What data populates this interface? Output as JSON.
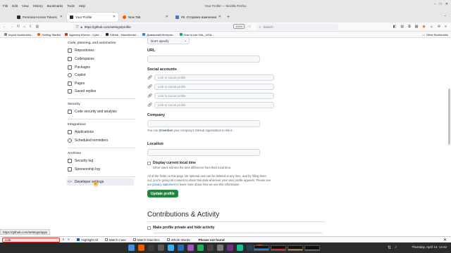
{
  "window": {
    "title": "Your Profile — Mozilla Firefox"
  },
  "menu": [
    "File",
    "Edit",
    "View",
    "History",
    "Bookmarks",
    "Tools",
    "Help"
  ],
  "tabs": [
    {
      "label": "Personal Access Tokens (Cl...",
      "color": "#24292f",
      "active": false
    },
    {
      "label": "Your Profile",
      "color": "#24292f",
      "active": true
    },
    {
      "label": "New Tab",
      "color": "#e66000",
      "active": false
    },
    {
      "label": "#8. Отправка изменений",
      "color": "#3e7cc0",
      "active": false
    }
  ],
  "nav": {
    "url": "https://github.com/settings/profile",
    "zoom": "110%",
    "search_placeholder": "Search"
  },
  "bookmarks": [
    {
      "label": "Import bookmarks...",
      "color": "#888888"
    },
    {
      "label": "Getting Started",
      "color": "#e66000"
    },
    {
      "label": "Адаптер Юнити - Cybe...",
      "color": "#c0392b"
    },
    {
      "label": "GitHub - NanoNerds/...",
      "color": "#24292f"
    },
    {
      "label": "Домашний Интерне...",
      "color": "#2e86de"
    },
    {
      "label": "How to use HAL_UGA...",
      "color": "#16a085"
    }
  ],
  "other_bookmarks": "Other Bookmarks",
  "sidebar": {
    "code_heading": "Code, planning, and automation",
    "code_items": [
      "Repositories",
      "Codespaces",
      "Packages",
      "Copilot",
      "Pages",
      "Saved replies"
    ],
    "security_heading": "Security",
    "security_items": [
      "Code security and analysis"
    ],
    "integrations_heading": "Integrations",
    "integrations_items": [
      "Applications",
      "Scheduled reminders"
    ],
    "archives_heading": "Archives",
    "archives_items": [
      "Security log",
      "Sponsorship log"
    ],
    "developer_settings": "Developer settings"
  },
  "form": {
    "pronouns_value": "Don't specify",
    "url_label": "URL",
    "social_label": "Social accounts",
    "social_placeholder": "Link to social profile",
    "company_label": "Company",
    "company_help_pre": "You can ",
    "company_help_mention": "@mention",
    "company_help_post": " your company's GitHub organization to link it.",
    "location_label": "Location",
    "local_time_label": "Display current local time",
    "local_time_help": "Other users will see the time difference from their local time.",
    "privacy_text_1": "All of the fields on this page are optional and can be deleted at any time, and by filling them",
    "privacy_text_2": "out, you're giving us consent to share this data wherever your user profile appears. Please see",
    "privacy_text_3_pre": "our ",
    "privacy_link": "privacy statement",
    "privacy_text_3_post": " to learn more about how we use this information.",
    "update_button": "Update profile",
    "contrib_heading": "Contributions & Activity",
    "private_label": "Make profile private and hide activity"
  },
  "status_url": "https://github.com/settings/apps",
  "findbar": {
    "query": "cola",
    "highlight_all": "Highlight All",
    "match_case": "Match Case",
    "match_diacritics": "Match Diacritics",
    "whole_words": "Whole Words",
    "status": "Phrase not found"
  },
  "taskbar": {
    "clock": "Thursday, April 13, 14:42",
    "icons": [
      "#4a90d9",
      "#e66000",
      "#3c3c3c",
      "#5a5a5a",
      "#3daee9",
      "#2b6cb0",
      "#9b59b6",
      "#27ae60",
      "#444444",
      "#7a7a7a",
      "#6c3483",
      "#1abc9c",
      "#2c3e50",
      "#c0392b"
    ]
  }
}
